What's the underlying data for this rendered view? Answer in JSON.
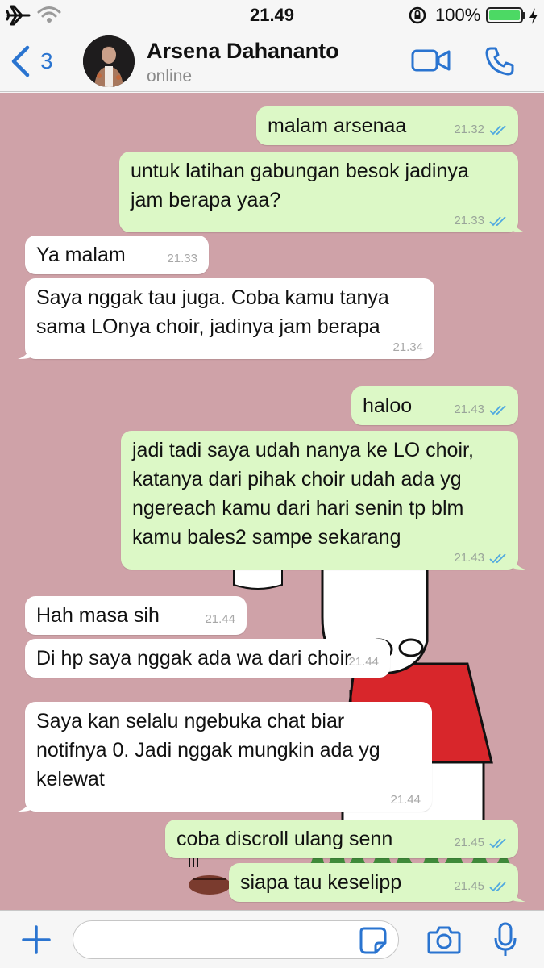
{
  "status_bar": {
    "time": "21.49",
    "battery_percent": "100%",
    "battery_level": 1.0,
    "icons": [
      "airplane-icon",
      "wifi-icon",
      "rotation-lock-icon",
      "battery-icon",
      "charging-bolt-icon"
    ]
  },
  "header": {
    "back_count": "3",
    "contact_name": "Arsena Dahananto",
    "contact_status": "online",
    "accent_color": "#2a74d0"
  },
  "colors": {
    "chat_background": "#cfa2a8",
    "outgoing_bubble": "#dcf8c6",
    "incoming_bubble": "#ffffff",
    "read_ticks": "#4fa8e0"
  },
  "messages": [
    {
      "direction": "out",
      "text": "malam arsenaa",
      "time": "21.32",
      "read": true
    },
    {
      "direction": "out",
      "text": "untuk latihan gabungan besok jadinya\njam berapa yaa?",
      "time": "21.33",
      "read": true
    },
    {
      "direction": "in",
      "text": "Ya malam",
      "time": "21.33"
    },
    {
      "direction": "in",
      "text": "Saya nggak tau juga. Coba kamu tanya\nsama LOnya choir, jadinya jam berapa",
      "time": "21.34"
    },
    {
      "direction": "out",
      "text": "haloo",
      "time": "21.43",
      "read": true
    },
    {
      "direction": "out",
      "text": "jadi tadi saya udah nanya ke LO choir,\nkatanya dari pihak choir udah ada yg\nngereach kamu dari hari senin tp blm\nkamu bales2 sampe sekarang",
      "time": "21.43",
      "read": true
    },
    {
      "direction": "in",
      "text": "Hah masa sih",
      "time": "21.44"
    },
    {
      "direction": "in",
      "text": "Di hp saya nggak ada wa dari choir",
      "time": "21.44"
    },
    {
      "direction": "in",
      "text": "Saya kan selalu ngebuka chat biar\nnotifnya 0. Jadi nggak mungkin ada yg\nkelewat",
      "time": "21.44"
    },
    {
      "direction": "out",
      "text": "coba discroll ulang senn",
      "time": "21.45",
      "read": true
    },
    {
      "direction": "out",
      "text": "siapa tau keselipp",
      "time": "21.45",
      "read": true
    }
  ],
  "input_bar": {
    "value": "",
    "placeholder": ""
  }
}
